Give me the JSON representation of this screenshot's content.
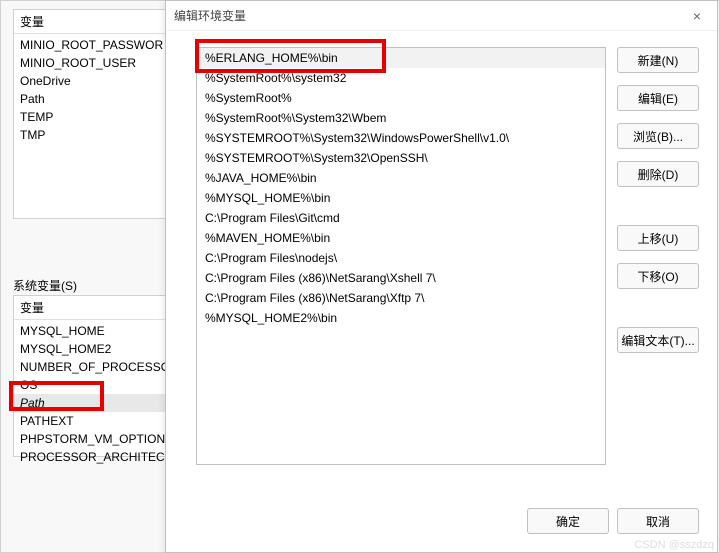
{
  "bg": {
    "user_vars_header": "变量",
    "user_vars": [
      "MINIO_ROOT_PASSWOR",
      "MINIO_ROOT_USER",
      "OneDrive",
      "Path",
      "TEMP",
      "TMP"
    ],
    "system_section_label": "系统变量(S)",
    "system_vars_header": "变量",
    "system_vars": [
      "MYSQL_HOME",
      "MYSQL_HOME2",
      "NUMBER_OF_PROCESSO",
      "OS",
      "Path",
      "PATHEXT",
      "PHPSTORM_VM_OPTION",
      "PROCESSOR_ARCHITECT"
    ]
  },
  "dialog": {
    "title": "编辑环境变量",
    "close_label": "×",
    "path_entries": [
      "%ERLANG_HOME%\\bin",
      "%SystemRoot%\\system32",
      "%SystemRoot%",
      "%SystemRoot%\\System32\\Wbem",
      "%SYSTEMROOT%\\System32\\WindowsPowerShell\\v1.0\\",
      "%SYSTEMROOT%\\System32\\OpenSSH\\",
      "%JAVA_HOME%\\bin",
      "%MYSQL_HOME%\\bin",
      "C:\\Program Files\\Git\\cmd",
      "%MAVEN_HOME%\\bin",
      "C:\\Program Files\\nodejs\\",
      "C:\\Program Files (x86)\\NetSarang\\Xshell 7\\",
      "C:\\Program Files (x86)\\NetSarang\\Xftp 7\\",
      "%MYSQL_HOME2%\\bin"
    ],
    "buttons": {
      "new": "新建(N)",
      "edit": "编辑(E)",
      "browse": "浏览(B)...",
      "delete": "删除(D)",
      "move_up": "上移(U)",
      "move_down": "下移(O)",
      "edit_text": "编辑文本(T)...",
      "ok": "确定",
      "cancel": "取消"
    }
  },
  "watermark": "CSDN @sszdzq"
}
